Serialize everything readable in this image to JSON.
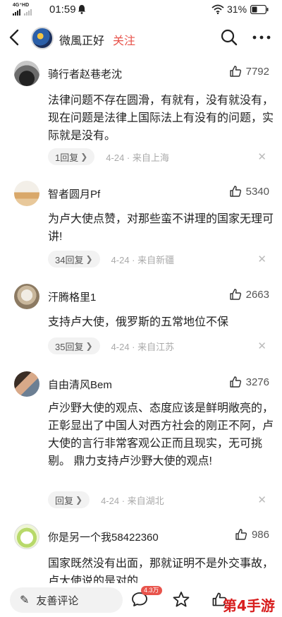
{
  "status_bar": {
    "network": "4G⁺HD",
    "time": "01:59",
    "battery": "31%"
  },
  "header": {
    "user_name": "微風正好",
    "follow_label": "关注"
  },
  "comments": [
    {
      "name": "骑行者赵巷老沈",
      "likes": "7792",
      "text": "法律问题不存在圆滑，有就有，没有就没有，现在问题是法律上国际法上有没有的问题，实际就是没有。",
      "replies": "1回复",
      "meta": "4-24 · 来自上海"
    },
    {
      "name": "智者圆月Pf",
      "likes": "5340",
      "text": "为卢大使点赞，对那些蛮不讲理的国家无理可讲!",
      "replies": "34回复",
      "meta": "4-24 · 来自新疆"
    },
    {
      "name": "汗腾格里1",
      "likes": "2663",
      "text": "支持卢大使，俄罗斯的五常地位不保",
      "replies": "35回复",
      "meta": "4-24 · 来自江苏"
    },
    {
      "name": "自由清风Bem",
      "likes": "3276",
      "text": "卢沙野大使的观点、态度应该是鲜明敞亮的，正彰显出了中国人对西方社会的刚正不阿，卢大使的言行非常客观公正而且现实，无可挑剔。 鼎力支持卢沙野大使的观点!",
      "replies": "回复",
      "meta": "4-24 · 来自湖北"
    },
    {
      "name": "你是另一个我58422360",
      "likes": "986",
      "text": "国家既然没有出面，那就证明不是外交事故，卢大使说的是对的"
    }
  ],
  "bottom_bar": {
    "input_placeholder": "友善评论",
    "comment_count": "4.3万"
  },
  "watermark": "第4手游"
}
